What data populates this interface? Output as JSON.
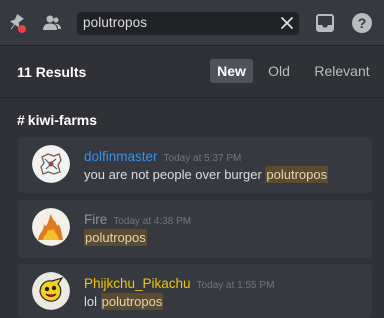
{
  "search": {
    "query": "polutropos"
  },
  "results": {
    "count_label": "11 Results",
    "sort_tabs": [
      {
        "label": "New",
        "active": true
      },
      {
        "label": "Old",
        "active": false
      },
      {
        "label": "Relevant",
        "active": false
      }
    ]
  },
  "channel": {
    "name": "kiwi-farms"
  },
  "messages": [
    {
      "author": "dolfinmaster",
      "timestamp": "Today at 5:37 PM",
      "text_before": "you are not people over burger ",
      "highlight": "polutropos",
      "text_after": "",
      "name_color": "#3a8ee6"
    },
    {
      "author": "Fire",
      "timestamp": "Today at 4:38 PM",
      "text_before": "",
      "highlight": "polutropos",
      "text_after": "",
      "name_color": "#8e9297"
    },
    {
      "author": "Phijkchu_Pikachu",
      "timestamp": "Today at 1:55 PM",
      "text_before": "lol ",
      "highlight": "polutropos",
      "text_after": "",
      "name_color": "#f1c40f"
    }
  ],
  "colors": {
    "background": "#2f3136",
    "card": "#36393f",
    "highlight_bg": "#5c4b2e",
    "active_tab": "#4f545c"
  },
  "icons": [
    "pin-muted-icon",
    "members-icon",
    "clear-icon",
    "inbox-icon",
    "help-icon"
  ]
}
